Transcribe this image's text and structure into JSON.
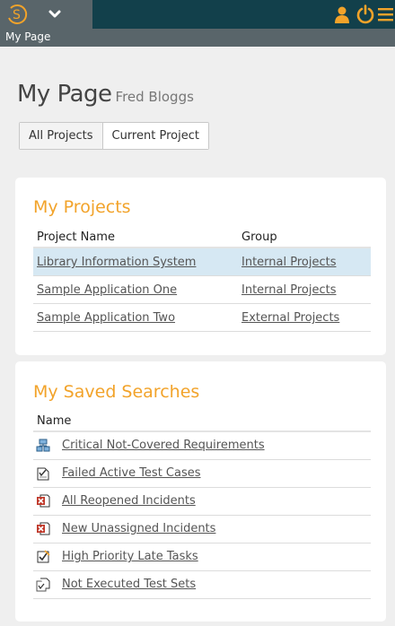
{
  "header": {
    "breadcrumb": "My Page",
    "icons": [
      "spira-logo-icon",
      "chevron-down-icon",
      "user-icon",
      "power-icon",
      "menu-icon"
    ],
    "colors": {
      "bar": "#12404b",
      "sub_bar": "#59656a",
      "accent": "#f2a32a"
    }
  },
  "page": {
    "title": "My Page",
    "user": "Fred Bloggs"
  },
  "filter": {
    "all_label": "All Projects",
    "current_label": "Current Project"
  },
  "projects": {
    "title": "My Projects",
    "columns": [
      "Project Name",
      "Group"
    ],
    "rows": [
      {
        "name": "Library Information System",
        "group": "Internal Projects"
      },
      {
        "name": "Sample Application One",
        "group": "Internal Projects"
      },
      {
        "name": "Sample Application Two",
        "group": "External Projects"
      }
    ]
  },
  "searches": {
    "title": "My Saved Searches",
    "column": "Name",
    "items": [
      {
        "label": "Critical Not-Covered Requirements",
        "icon": "requirement-icon"
      },
      {
        "label": "Failed Active Test Cases",
        "icon": "test-case-icon"
      },
      {
        "label": "All Reopened Incidents",
        "icon": "incident-icon"
      },
      {
        "label": "New Unassigned Incidents",
        "icon": "incident-icon"
      },
      {
        "label": "High Priority Late Tasks",
        "icon": "task-icon"
      },
      {
        "label": "Not Executed Test Sets",
        "icon": "test-set-icon"
      }
    ]
  }
}
